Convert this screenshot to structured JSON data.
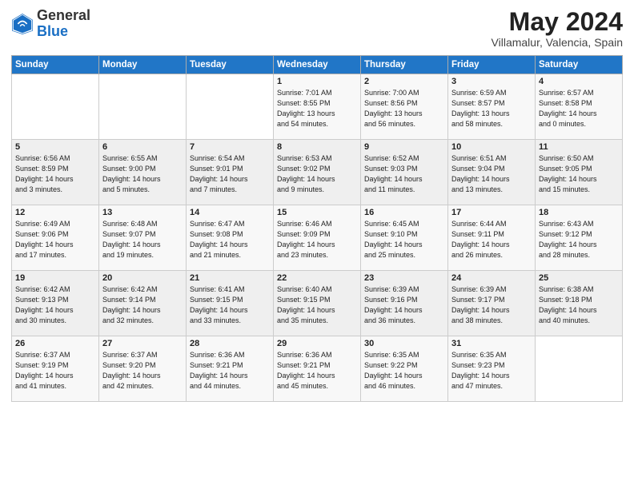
{
  "header": {
    "logo_general": "General",
    "logo_blue": "Blue",
    "month_year": "May 2024",
    "location": "Villamalur, Valencia, Spain"
  },
  "days_of_week": [
    "Sunday",
    "Monday",
    "Tuesday",
    "Wednesday",
    "Thursday",
    "Friday",
    "Saturday"
  ],
  "weeks": [
    [
      {
        "day": "",
        "info": ""
      },
      {
        "day": "",
        "info": ""
      },
      {
        "day": "",
        "info": ""
      },
      {
        "day": "1",
        "info": "Sunrise: 7:01 AM\nSunset: 8:55 PM\nDaylight: 13 hours\nand 54 minutes."
      },
      {
        "day": "2",
        "info": "Sunrise: 7:00 AM\nSunset: 8:56 PM\nDaylight: 13 hours\nand 56 minutes."
      },
      {
        "day": "3",
        "info": "Sunrise: 6:59 AM\nSunset: 8:57 PM\nDaylight: 13 hours\nand 58 minutes."
      },
      {
        "day": "4",
        "info": "Sunrise: 6:57 AM\nSunset: 8:58 PM\nDaylight: 14 hours\nand 0 minutes."
      }
    ],
    [
      {
        "day": "5",
        "info": "Sunrise: 6:56 AM\nSunset: 8:59 PM\nDaylight: 14 hours\nand 3 minutes."
      },
      {
        "day": "6",
        "info": "Sunrise: 6:55 AM\nSunset: 9:00 PM\nDaylight: 14 hours\nand 5 minutes."
      },
      {
        "day": "7",
        "info": "Sunrise: 6:54 AM\nSunset: 9:01 PM\nDaylight: 14 hours\nand 7 minutes."
      },
      {
        "day": "8",
        "info": "Sunrise: 6:53 AM\nSunset: 9:02 PM\nDaylight: 14 hours\nand 9 minutes."
      },
      {
        "day": "9",
        "info": "Sunrise: 6:52 AM\nSunset: 9:03 PM\nDaylight: 14 hours\nand 11 minutes."
      },
      {
        "day": "10",
        "info": "Sunrise: 6:51 AM\nSunset: 9:04 PM\nDaylight: 14 hours\nand 13 minutes."
      },
      {
        "day": "11",
        "info": "Sunrise: 6:50 AM\nSunset: 9:05 PM\nDaylight: 14 hours\nand 15 minutes."
      }
    ],
    [
      {
        "day": "12",
        "info": "Sunrise: 6:49 AM\nSunset: 9:06 PM\nDaylight: 14 hours\nand 17 minutes."
      },
      {
        "day": "13",
        "info": "Sunrise: 6:48 AM\nSunset: 9:07 PM\nDaylight: 14 hours\nand 19 minutes."
      },
      {
        "day": "14",
        "info": "Sunrise: 6:47 AM\nSunset: 9:08 PM\nDaylight: 14 hours\nand 21 minutes."
      },
      {
        "day": "15",
        "info": "Sunrise: 6:46 AM\nSunset: 9:09 PM\nDaylight: 14 hours\nand 23 minutes."
      },
      {
        "day": "16",
        "info": "Sunrise: 6:45 AM\nSunset: 9:10 PM\nDaylight: 14 hours\nand 25 minutes."
      },
      {
        "day": "17",
        "info": "Sunrise: 6:44 AM\nSunset: 9:11 PM\nDaylight: 14 hours\nand 26 minutes."
      },
      {
        "day": "18",
        "info": "Sunrise: 6:43 AM\nSunset: 9:12 PM\nDaylight: 14 hours\nand 28 minutes."
      }
    ],
    [
      {
        "day": "19",
        "info": "Sunrise: 6:42 AM\nSunset: 9:13 PM\nDaylight: 14 hours\nand 30 minutes."
      },
      {
        "day": "20",
        "info": "Sunrise: 6:42 AM\nSunset: 9:14 PM\nDaylight: 14 hours\nand 32 minutes."
      },
      {
        "day": "21",
        "info": "Sunrise: 6:41 AM\nSunset: 9:15 PM\nDaylight: 14 hours\nand 33 minutes."
      },
      {
        "day": "22",
        "info": "Sunrise: 6:40 AM\nSunset: 9:15 PM\nDaylight: 14 hours\nand 35 minutes."
      },
      {
        "day": "23",
        "info": "Sunrise: 6:39 AM\nSunset: 9:16 PM\nDaylight: 14 hours\nand 36 minutes."
      },
      {
        "day": "24",
        "info": "Sunrise: 6:39 AM\nSunset: 9:17 PM\nDaylight: 14 hours\nand 38 minutes."
      },
      {
        "day": "25",
        "info": "Sunrise: 6:38 AM\nSunset: 9:18 PM\nDaylight: 14 hours\nand 40 minutes."
      }
    ],
    [
      {
        "day": "26",
        "info": "Sunrise: 6:37 AM\nSunset: 9:19 PM\nDaylight: 14 hours\nand 41 minutes."
      },
      {
        "day": "27",
        "info": "Sunrise: 6:37 AM\nSunset: 9:20 PM\nDaylight: 14 hours\nand 42 minutes."
      },
      {
        "day": "28",
        "info": "Sunrise: 6:36 AM\nSunset: 9:21 PM\nDaylight: 14 hours\nand 44 minutes."
      },
      {
        "day": "29",
        "info": "Sunrise: 6:36 AM\nSunset: 9:21 PM\nDaylight: 14 hours\nand 45 minutes."
      },
      {
        "day": "30",
        "info": "Sunrise: 6:35 AM\nSunset: 9:22 PM\nDaylight: 14 hours\nand 46 minutes."
      },
      {
        "day": "31",
        "info": "Sunrise: 6:35 AM\nSunset: 9:23 PM\nDaylight: 14 hours\nand 47 minutes."
      },
      {
        "day": "",
        "info": ""
      }
    ]
  ]
}
